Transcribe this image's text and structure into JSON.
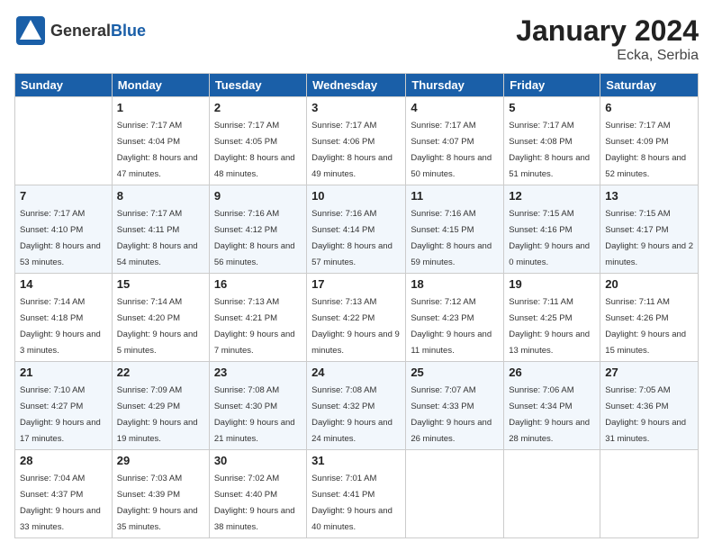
{
  "header": {
    "logo_general": "General",
    "logo_blue": "Blue",
    "title": "January 2024",
    "subtitle": "Ecka, Serbia"
  },
  "calendar": {
    "days_of_week": [
      "Sunday",
      "Monday",
      "Tuesday",
      "Wednesday",
      "Thursday",
      "Friday",
      "Saturday"
    ],
    "weeks": [
      [
        {
          "day": "",
          "sunrise": "",
          "sunset": "",
          "daylight": ""
        },
        {
          "day": "1",
          "sunrise": "Sunrise: 7:17 AM",
          "sunset": "Sunset: 4:04 PM",
          "daylight": "Daylight: 8 hours and 47 minutes."
        },
        {
          "day": "2",
          "sunrise": "Sunrise: 7:17 AM",
          "sunset": "Sunset: 4:05 PM",
          "daylight": "Daylight: 8 hours and 48 minutes."
        },
        {
          "day": "3",
          "sunrise": "Sunrise: 7:17 AM",
          "sunset": "Sunset: 4:06 PM",
          "daylight": "Daylight: 8 hours and 49 minutes."
        },
        {
          "day": "4",
          "sunrise": "Sunrise: 7:17 AM",
          "sunset": "Sunset: 4:07 PM",
          "daylight": "Daylight: 8 hours and 50 minutes."
        },
        {
          "day": "5",
          "sunrise": "Sunrise: 7:17 AM",
          "sunset": "Sunset: 4:08 PM",
          "daylight": "Daylight: 8 hours and 51 minutes."
        },
        {
          "day": "6",
          "sunrise": "Sunrise: 7:17 AM",
          "sunset": "Sunset: 4:09 PM",
          "daylight": "Daylight: 8 hours and 52 minutes."
        }
      ],
      [
        {
          "day": "7",
          "sunrise": "Sunrise: 7:17 AM",
          "sunset": "Sunset: 4:10 PM",
          "daylight": "Daylight: 8 hours and 53 minutes."
        },
        {
          "day": "8",
          "sunrise": "Sunrise: 7:17 AM",
          "sunset": "Sunset: 4:11 PM",
          "daylight": "Daylight: 8 hours and 54 minutes."
        },
        {
          "day": "9",
          "sunrise": "Sunrise: 7:16 AM",
          "sunset": "Sunset: 4:12 PM",
          "daylight": "Daylight: 8 hours and 56 minutes."
        },
        {
          "day": "10",
          "sunrise": "Sunrise: 7:16 AM",
          "sunset": "Sunset: 4:14 PM",
          "daylight": "Daylight: 8 hours and 57 minutes."
        },
        {
          "day": "11",
          "sunrise": "Sunrise: 7:16 AM",
          "sunset": "Sunset: 4:15 PM",
          "daylight": "Daylight: 8 hours and 59 minutes."
        },
        {
          "day": "12",
          "sunrise": "Sunrise: 7:15 AM",
          "sunset": "Sunset: 4:16 PM",
          "daylight": "Daylight: 9 hours and 0 minutes."
        },
        {
          "day": "13",
          "sunrise": "Sunrise: 7:15 AM",
          "sunset": "Sunset: 4:17 PM",
          "daylight": "Daylight: 9 hours and 2 minutes."
        }
      ],
      [
        {
          "day": "14",
          "sunrise": "Sunrise: 7:14 AM",
          "sunset": "Sunset: 4:18 PM",
          "daylight": "Daylight: 9 hours and 3 minutes."
        },
        {
          "day": "15",
          "sunrise": "Sunrise: 7:14 AM",
          "sunset": "Sunset: 4:20 PM",
          "daylight": "Daylight: 9 hours and 5 minutes."
        },
        {
          "day": "16",
          "sunrise": "Sunrise: 7:13 AM",
          "sunset": "Sunset: 4:21 PM",
          "daylight": "Daylight: 9 hours and 7 minutes."
        },
        {
          "day": "17",
          "sunrise": "Sunrise: 7:13 AM",
          "sunset": "Sunset: 4:22 PM",
          "daylight": "Daylight: 9 hours and 9 minutes."
        },
        {
          "day": "18",
          "sunrise": "Sunrise: 7:12 AM",
          "sunset": "Sunset: 4:23 PM",
          "daylight": "Daylight: 9 hours and 11 minutes."
        },
        {
          "day": "19",
          "sunrise": "Sunrise: 7:11 AM",
          "sunset": "Sunset: 4:25 PM",
          "daylight": "Daylight: 9 hours and 13 minutes."
        },
        {
          "day": "20",
          "sunrise": "Sunrise: 7:11 AM",
          "sunset": "Sunset: 4:26 PM",
          "daylight": "Daylight: 9 hours and 15 minutes."
        }
      ],
      [
        {
          "day": "21",
          "sunrise": "Sunrise: 7:10 AM",
          "sunset": "Sunset: 4:27 PM",
          "daylight": "Daylight: 9 hours and 17 minutes."
        },
        {
          "day": "22",
          "sunrise": "Sunrise: 7:09 AM",
          "sunset": "Sunset: 4:29 PM",
          "daylight": "Daylight: 9 hours and 19 minutes."
        },
        {
          "day": "23",
          "sunrise": "Sunrise: 7:08 AM",
          "sunset": "Sunset: 4:30 PM",
          "daylight": "Daylight: 9 hours and 21 minutes."
        },
        {
          "day": "24",
          "sunrise": "Sunrise: 7:08 AM",
          "sunset": "Sunset: 4:32 PM",
          "daylight": "Daylight: 9 hours and 24 minutes."
        },
        {
          "day": "25",
          "sunrise": "Sunrise: 7:07 AM",
          "sunset": "Sunset: 4:33 PM",
          "daylight": "Daylight: 9 hours and 26 minutes."
        },
        {
          "day": "26",
          "sunrise": "Sunrise: 7:06 AM",
          "sunset": "Sunset: 4:34 PM",
          "daylight": "Daylight: 9 hours and 28 minutes."
        },
        {
          "day": "27",
          "sunrise": "Sunrise: 7:05 AM",
          "sunset": "Sunset: 4:36 PM",
          "daylight": "Daylight: 9 hours and 31 minutes."
        }
      ],
      [
        {
          "day": "28",
          "sunrise": "Sunrise: 7:04 AM",
          "sunset": "Sunset: 4:37 PM",
          "daylight": "Daylight: 9 hours and 33 minutes."
        },
        {
          "day": "29",
          "sunrise": "Sunrise: 7:03 AM",
          "sunset": "Sunset: 4:39 PM",
          "daylight": "Daylight: 9 hours and 35 minutes."
        },
        {
          "day": "30",
          "sunrise": "Sunrise: 7:02 AM",
          "sunset": "Sunset: 4:40 PM",
          "daylight": "Daylight: 9 hours and 38 minutes."
        },
        {
          "day": "31",
          "sunrise": "Sunrise: 7:01 AM",
          "sunset": "Sunset: 4:41 PM",
          "daylight": "Daylight: 9 hours and 40 minutes."
        },
        {
          "day": "",
          "sunrise": "",
          "sunset": "",
          "daylight": ""
        },
        {
          "day": "",
          "sunrise": "",
          "sunset": "",
          "daylight": ""
        },
        {
          "day": "",
          "sunrise": "",
          "sunset": "",
          "daylight": ""
        }
      ]
    ]
  }
}
